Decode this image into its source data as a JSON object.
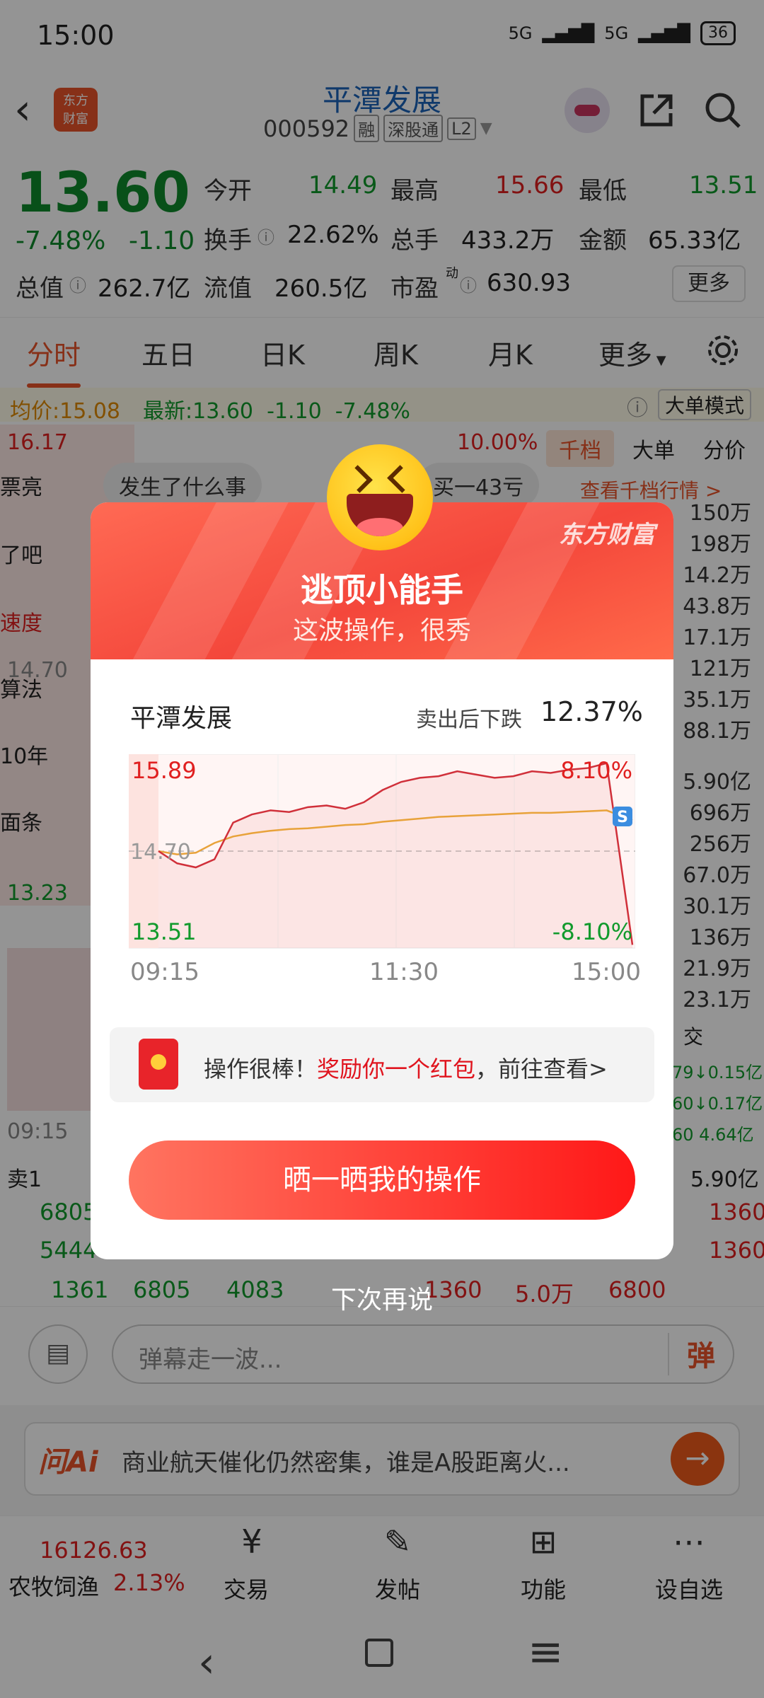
{
  "status": {
    "time": "15:00",
    "signal1": "5G",
    "signal2": "5G",
    "battery": "36"
  },
  "header": {
    "logo_line1": "东方",
    "logo_line2": "财富",
    "title": "平潭发展",
    "code": "000592",
    "tags": [
      "融",
      "深股通",
      "L2"
    ]
  },
  "quote": {
    "price": "13.60",
    "change_pct": "-7.48%",
    "change": "-1.10",
    "open_label": "今开",
    "open": "14.49",
    "high_label": "最高",
    "high": "15.66",
    "low_label": "最低",
    "low": "13.51",
    "turnover_label": "换手",
    "turnover": "22.62%",
    "volume_label": "总手",
    "volume": "433.2万",
    "amount_label": "金额",
    "amount": "65.33亿",
    "mcap_label": "总值",
    "mcap": "262.7亿",
    "float_label": "流值",
    "float": "260.5亿",
    "pe_label": "市盈",
    "pe_sup": "动",
    "pe": "630.93",
    "more": "更多"
  },
  "tabs": [
    "分时",
    "五日",
    "日K",
    "周K",
    "月K",
    "更多"
  ],
  "chart_info": {
    "avg_label": "均价:",
    "avg": "15.08",
    "latest_label": "最新:",
    "latest": "13.60",
    "chg": "-1.10",
    "pct": "-7.48%",
    "mode": "大单模式",
    "top": "16.17",
    "top_pct": "10.00%",
    "mid": "14.70",
    "bottom": "13.23",
    "time": "09:15"
  },
  "side_tabs": [
    "千档",
    "大单",
    "分价"
  ],
  "side_link": "查看千档行情 >",
  "bubbles": [
    "发生了什么事",
    "买一43亏"
  ],
  "left_snips": [
    "票亮",
    "了吧",
    "速度",
    "算法",
    "10年",
    "面条"
  ],
  "right_vals": [
    "150万",
    "198万",
    "14.2万",
    "43.8万",
    "17.1万",
    "121万",
    "35.1万",
    "88.1万",
    "5.90亿",
    "696万",
    "256万",
    "67.0万",
    "30.1万",
    "136万",
    "21.9万",
    "23.1万"
  ],
  "bottom_rows": {
    "sell1": "卖1",
    "sell1_amt": "5.90亿",
    "r1": "6805",
    "r2": "5444",
    "r3a": "1361",
    "r3b": "6805",
    "r3c": "4083",
    "r3d": "1360",
    "r3e": "5.0万",
    "r3f": "6800",
    "r1b": "1360",
    "r2b": "1360",
    "trade_head": "交",
    "trades": [
      "79↓0.15亿",
      "60↓0.17亿",
      "60 4.64亿"
    ]
  },
  "danmu_placeholder": "弹幕走一波...",
  "danmu_btn": "弹",
  "ai": {
    "label": "问Ai",
    "text": "商业航天催化仍然密集，谁是A股距离火..."
  },
  "index": {
    "value": "16126.63",
    "name": "农牧饲渔",
    "pct": "2.13%"
  },
  "nav": [
    "交易",
    "发帖",
    "功能",
    "设自选"
  ],
  "modal": {
    "brand": "东方财富",
    "title": "逃顶小能手",
    "subtitle": "这波操作，很秀",
    "stock": "平潭发展",
    "drop_label": "卖出后下跌",
    "drop": "12.37%",
    "reward_pre": "操作很棒！",
    "reward_red": "奖励你一个红包",
    "reward_post": "，前往查看>",
    "cta": "晒一晒我的操作",
    "later": "下次再说"
  },
  "chart_data": {
    "type": "line",
    "title": "",
    "xlabel": "",
    "ylabel": "",
    "x_ticks": [
      "09:15",
      "11:30",
      "15:00"
    ],
    "ylim": [
      13.51,
      15.89
    ],
    "y_ref": 14.7,
    "y_left_labels": [
      "15.89",
      "14.70",
      "13.51"
    ],
    "y_right_labels": [
      "8.10%",
      "-8.10%"
    ],
    "series": [
      {
        "values": [
          14.7,
          14.55,
          14.5,
          14.6,
          15.05,
          15.15,
          15.2,
          15.18,
          15.24,
          15.26,
          15.22,
          15.3,
          15.45,
          15.55,
          15.6,
          15.62,
          15.68,
          15.64,
          15.6,
          15.62,
          15.68,
          15.66,
          15.7,
          15.72,
          15.78,
          13.55
        ]
      },
      {
        "values": [
          14.7,
          14.66,
          14.68,
          14.8,
          14.88,
          14.92,
          14.95,
          14.97,
          14.98,
          15.0,
          15.02,
          15.03,
          15.06,
          15.08,
          15.1,
          15.12,
          15.13,
          15.14,
          15.15,
          15.16,
          15.17,
          15.17,
          15.18,
          15.19,
          15.2,
          15.08
        ]
      }
    ]
  }
}
